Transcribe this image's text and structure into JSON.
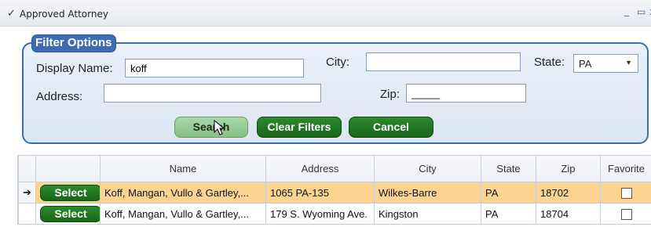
{
  "window": {
    "title": "Approved Attorney",
    "check_glyph": "✓",
    "minimize_glyph": "_",
    "maximize_glyph": "▭",
    "close_glyph": "x"
  },
  "filter": {
    "legend": "Filter Options",
    "display_name_label": "Display Name:",
    "display_name_value": "koff",
    "city_label": "City:",
    "city_value": "",
    "state_label": "State:",
    "state_value": "PA",
    "address_label": "Address:",
    "address_value": "",
    "zip_label": "Zip:",
    "zip_value": "_____",
    "buttons": {
      "search": "Search",
      "clear": "Clear Filters",
      "cancel": "Cancel"
    }
  },
  "grid": {
    "columns": [
      "",
      "",
      "Name",
      "Address",
      "City",
      "State",
      "Zip",
      "Favorite"
    ],
    "rows": [
      {
        "indicator": "➔",
        "action": "Select",
        "name": "Koff, Mangan, Vullo & Gartley,...",
        "address": "1065 PA-135",
        "city": "Wilkes-Barre",
        "state": "PA",
        "zip": "18702",
        "favorite": false,
        "selected": true
      },
      {
        "indicator": "",
        "action": "Select",
        "name": "Koff, Mangan, Vullo & Gartley,...",
        "address": "179 S. Wyoming Ave.",
        "city": "Kingston",
        "state": "PA",
        "zip": "18704",
        "favorite": false,
        "selected": false
      }
    ]
  },
  "colors": {
    "accent_blue": "#3f6bb0",
    "button_green": "#1f7a1f",
    "row_highlight": "#fcd391"
  }
}
